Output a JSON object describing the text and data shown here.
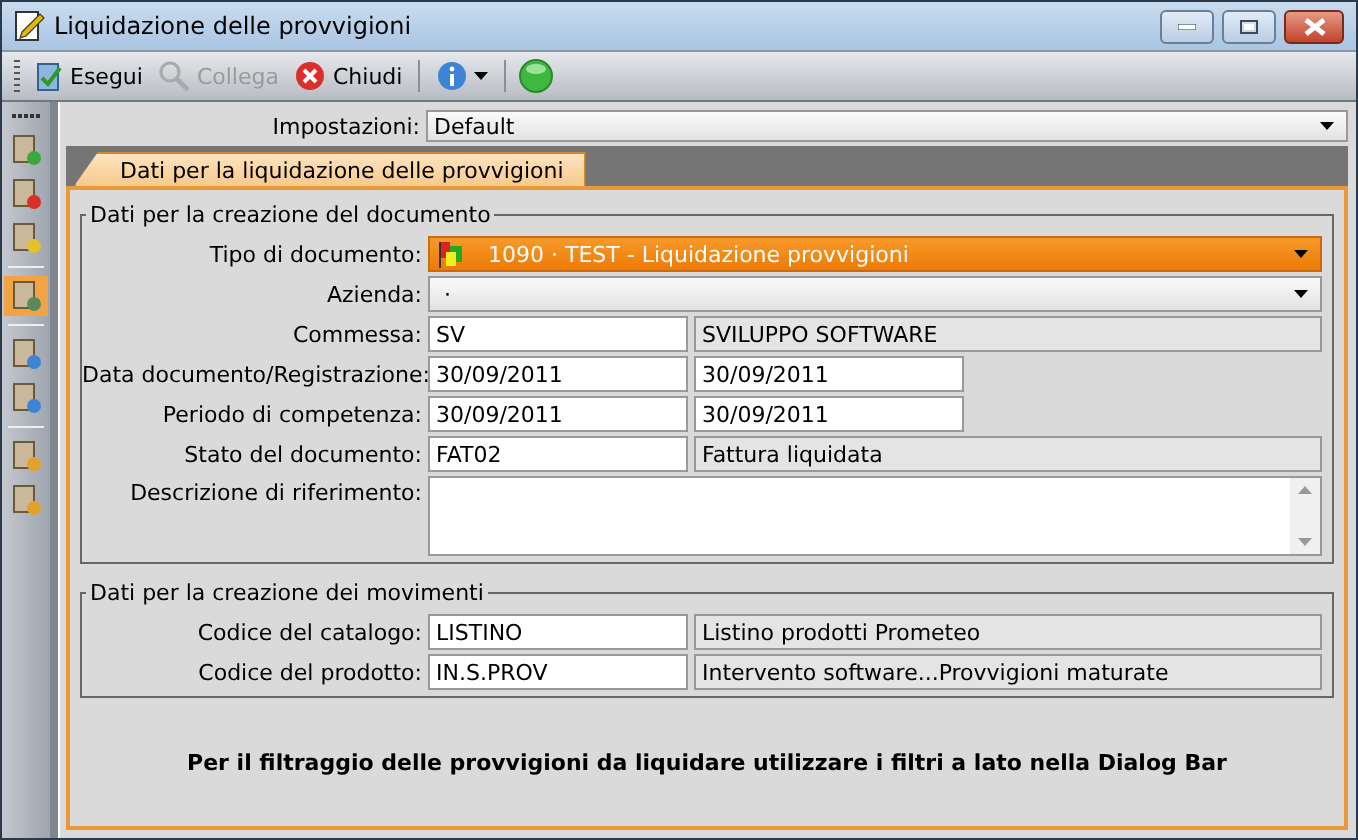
{
  "window": {
    "title": "Liquidazione delle provvigioni"
  },
  "toolbar": [
    {
      "kind": "button",
      "label": "Esegui",
      "disabled": false
    },
    {
      "kind": "button",
      "label": "Collega",
      "disabled": true
    },
    {
      "kind": "button",
      "label": "Chiudi",
      "disabled": false
    },
    {
      "kind": "menu"
    },
    {
      "kind": "icon"
    }
  ],
  "sidebar": {
    "items": [
      {
        "selected": false
      },
      {
        "selected": false
      },
      {
        "selected": false
      },
      {
        "selected": true
      },
      {
        "selected": false
      },
      {
        "selected": false
      },
      {
        "selected": false
      },
      {
        "selected": false
      }
    ]
  },
  "settings": {
    "label": "Impostazioni:",
    "value": "Default"
  },
  "tabs": [
    {
      "label": "Dati per la liquidazione delle provvigioni",
      "selected": true
    }
  ],
  "groups": [
    {
      "title": "Dati per la creazione del documento",
      "rows": [
        {
          "kind": "dropdown",
          "label": "Tipo di documento:",
          "value": "1090 · TEST - Liquidazione provvigioni",
          "highlighted": true
        },
        {
          "kind": "dropdown",
          "label": "Azienda:",
          "value": "·",
          "highlighted": false
        },
        {
          "kind": "code",
          "label": "Commessa:",
          "value": "SV",
          "description": "SVILUPPO SOFTWARE"
        },
        {
          "kind": "range",
          "label": "Data documento/Registrazione:",
          "from": "30/09/2011",
          "to": "30/09/2011"
        },
        {
          "kind": "range",
          "label": "Periodo di competenza:",
          "from": "30/09/2011",
          "to": "30/09/2011"
        },
        {
          "kind": "code",
          "label": "Stato del documento:",
          "value": "FAT02",
          "description": "Fattura liquidata"
        },
        {
          "kind": "memo",
          "label": "Descrizione di riferimento:"
        }
      ]
    },
    {
      "title": "Dati per la creazione dei movimenti",
      "rows": [
        {
          "kind": "code",
          "label": "Codice del catalogo:",
          "value": "LISTINO",
          "description": "Listino prodotti Prometeo"
        },
        {
          "kind": "code",
          "label": "Codice del prodotto:",
          "value": "IN.S.PROV",
          "description": "Intervento software...Provvigioni maturate"
        }
      ]
    }
  ],
  "note": "Per il filtraggio delle provvigioni da liquidare utilizzare i filtri a lato nella Dialog Bar"
}
